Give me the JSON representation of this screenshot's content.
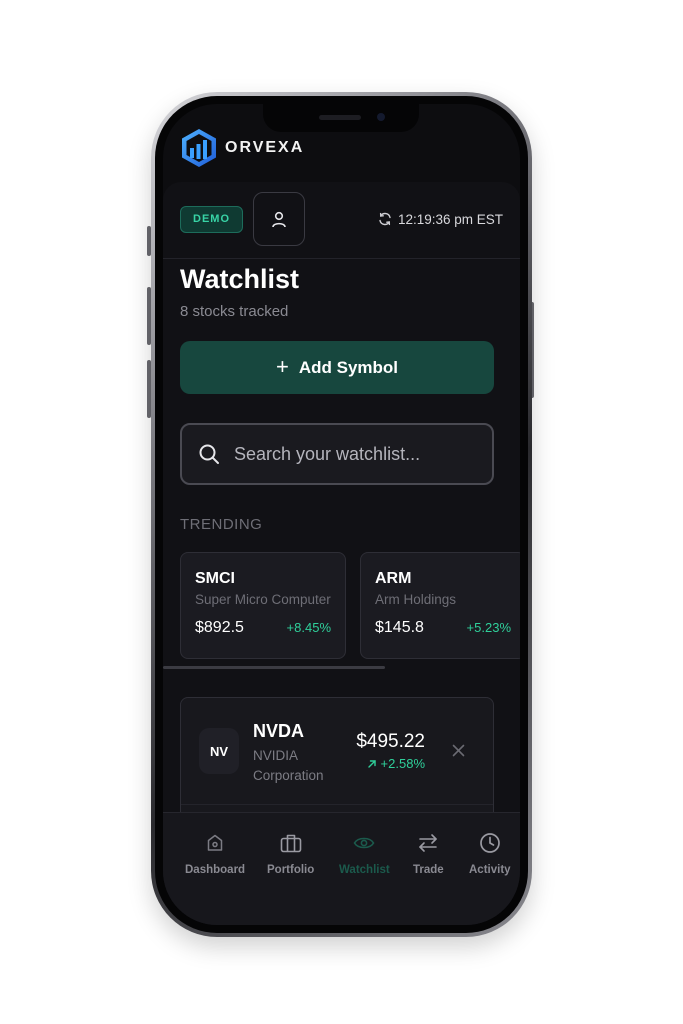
{
  "app": {
    "brand_name": "ORVEXA"
  },
  "header": {
    "demo_badge": "DEMO",
    "clock_time": "12:19:36 pm EST"
  },
  "page": {
    "title": "Watchlist",
    "subtitle": "8 stocks tracked"
  },
  "actions": {
    "add_symbol_label": "Add Symbol",
    "add_symbol_icon": "+"
  },
  "search": {
    "placeholder": "Search your watchlist...",
    "value": ""
  },
  "trending": {
    "label": "TRENDING",
    "items": [
      {
        "symbol": "SMCI",
        "name": "Super Micro Computer",
        "price": "$892.5",
        "change": "+8.45%"
      },
      {
        "symbol": "ARM",
        "name": "Arm Holdings",
        "price": "$145.8",
        "change": "+5.23%"
      }
    ]
  },
  "watchlist": {
    "items": [
      {
        "initials": "NV",
        "symbol": "NVDA",
        "name": "NVIDIA Corporation",
        "price": "$495.22",
        "change": "+2.58%"
      }
    ]
  },
  "nav": {
    "items": [
      {
        "label": "Dashboard",
        "icon": "home-icon"
      },
      {
        "label": "Portfolio",
        "icon": "briefcase-icon"
      },
      {
        "label": "Watchlist",
        "icon": "eye-icon",
        "active": true
      },
      {
        "label": "Trade",
        "icon": "swap-arrows-icon"
      },
      {
        "label": "Activity",
        "icon": "clock-icon"
      }
    ]
  },
  "colors": {
    "accent": "#17473e",
    "positive": "#2fcf9a",
    "background": "#111115",
    "demo_badge_text": "#38d3a6"
  }
}
